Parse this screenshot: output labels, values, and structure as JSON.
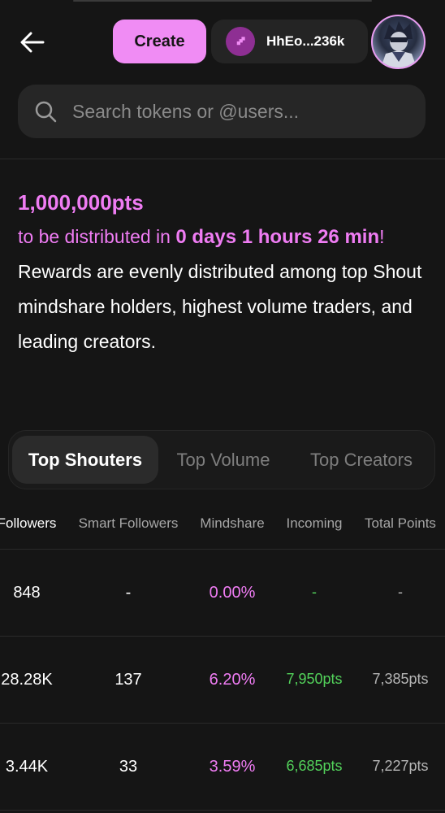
{
  "header": {
    "create_label": "Create",
    "wallet_label": "HhEo...236k"
  },
  "search": {
    "placeholder": "Search tokens or @users..."
  },
  "reward": {
    "points": "1,000,000pts",
    "distribute_prefix": "to be distributed in ",
    "countdown": "0 days 1 hours 26 min",
    "distribute_suffix": "!",
    "description": "Rewards are evenly distributed among top Shout mindshare holders, highest volume traders, and leading creators."
  },
  "tabs": [
    {
      "label": "Top Shouters",
      "active": true
    },
    {
      "label": "Top Volume",
      "active": false
    },
    {
      "label": "Top Creators",
      "active": false
    }
  ],
  "table": {
    "columns": [
      "Followers",
      "Smart Followers",
      "Mindshare",
      "Incoming",
      "Total Points"
    ],
    "rows": [
      {
        "followers": "848",
        "smart_followers": "-",
        "mindshare": "0.00%",
        "incoming": "-",
        "total_points": "-"
      },
      {
        "followers": "28.28K",
        "smart_followers": "137",
        "mindshare": "6.20%",
        "incoming": "7,950pts",
        "total_points": "7,385pts"
      },
      {
        "followers": "3.44K",
        "smart_followers": "33",
        "mindshare": "3.59%",
        "incoming": "6,685pts",
        "total_points": "7,227pts"
      }
    ]
  },
  "colors": {
    "accent_pink": "#ef7cf3",
    "create_button": "#f08cf4",
    "incoming_green": "#52d15a",
    "background": "#151515"
  },
  "icons": {
    "back": "arrow-left-icon",
    "wallet": "puzzle-icon",
    "search": "search-icon"
  }
}
